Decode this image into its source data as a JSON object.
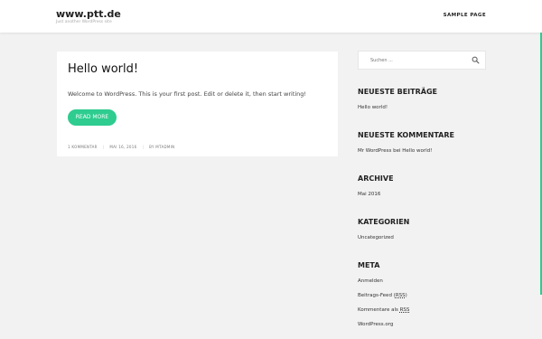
{
  "header": {
    "site_title": "www.ptt.de",
    "site_description": "Just another WordPress site",
    "nav": [
      {
        "label": "SAMPLE PAGE"
      }
    ]
  },
  "post": {
    "title": "Hello world!",
    "excerpt": "Welcome to WordPress. This is your first post. Edit or delete it, then start writing!",
    "read_more": "READ MORE",
    "meta": {
      "comments": "1 KOMMENTAR",
      "date": "MAI 16, 2016",
      "author": "BY MTADMIN"
    }
  },
  "sidebar": {
    "search": {
      "placeholder": "Suchen ..."
    },
    "recent_posts": {
      "title": "NEUESTE BEITRÄGE",
      "items": [
        "Hello world!"
      ]
    },
    "recent_comments": {
      "title": "NEUESTE KOMMENTARE",
      "items": [
        {
          "author": "Mr WordPress",
          "connector": "bei",
          "post": "Hello world!"
        }
      ]
    },
    "archive": {
      "title": "ARCHIVE",
      "items": [
        "Mai 2016"
      ]
    },
    "categories": {
      "title": "KATEGORIEN",
      "items": [
        "Uncategorized"
      ]
    },
    "meta": {
      "title": "META",
      "login": "Anmelden",
      "entries_feed": {
        "label": "Beitrags-Feed",
        "abbr": "RSS"
      },
      "comments_feed": {
        "label": "Kommentare als",
        "abbr": "RSS"
      },
      "wordpress_org": "WordPress.org"
    }
  },
  "colors": {
    "accent": "#2ecc8f",
    "background": "#f2f2f2"
  },
  "icons": {
    "search": "search-icon"
  }
}
